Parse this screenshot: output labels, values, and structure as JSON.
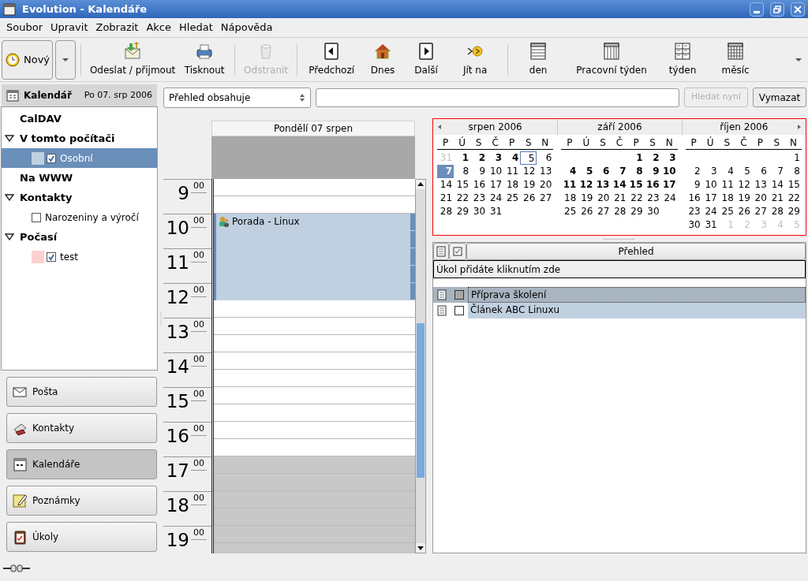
{
  "window": {
    "title": "Evolution - Kalendáře"
  },
  "menu": [
    "Soubor",
    "Upravit",
    "Zobrazit",
    "Akce",
    "Hledat",
    "Nápověda"
  ],
  "toolbar": [
    {
      "kind": "new",
      "label": "Nový",
      "disabled": false
    },
    {
      "kind": "send",
      "label": "Odeslat / přijmout",
      "disabled": false
    },
    {
      "kind": "print",
      "label": "Tisknout",
      "disabled": false
    },
    {
      "kind": "delete",
      "label": "Odstranit",
      "disabled": true
    },
    {
      "kind": "prev",
      "label": "Předchozí",
      "disabled": false
    },
    {
      "kind": "today",
      "label": "Dnes",
      "disabled": false
    },
    {
      "kind": "next",
      "label": "Další",
      "disabled": false
    },
    {
      "kind": "goto",
      "label": "Jít na",
      "disabled": false
    },
    {
      "kind": "day",
      "label": "den",
      "disabled": false
    },
    {
      "kind": "workweek",
      "label": "Pracovní týden",
      "disabled": false
    },
    {
      "kind": "week",
      "label": "týden",
      "disabled": false
    },
    {
      "kind": "month",
      "label": "měsíc",
      "disabled": false
    }
  ],
  "sidebar": {
    "title": "Kalendář",
    "date": "Po 07. srp 2006",
    "tree": [
      {
        "label": "CalDAV"
      },
      {
        "label": "V tomto počítači",
        "expanded": true,
        "children": [
          {
            "label": "Osobní",
            "color": "#c0d0e0",
            "checked": true,
            "selected": true
          }
        ]
      },
      {
        "label": "Na WWW"
      },
      {
        "label": "Kontakty",
        "expanded": true,
        "children": [
          {
            "label": "Narozeniny a výročí",
            "checked": false,
            "selected": false
          }
        ]
      },
      {
        "label": "Počasí",
        "expanded": true,
        "children": [
          {
            "label": "test",
            "color": "#ffd0d0",
            "checked": true,
            "selected": false
          }
        ]
      }
    ],
    "switcher": [
      {
        "kind": "mail",
        "label": "Pošta",
        "selected": false
      },
      {
        "kind": "contacts",
        "label": "Kontakty",
        "selected": false
      },
      {
        "kind": "calendar",
        "label": "Kalendáře",
        "selected": true
      },
      {
        "kind": "memos",
        "label": "Poznámky",
        "selected": false
      },
      {
        "kind": "tasks",
        "label": "Úkoly",
        "selected": false
      }
    ]
  },
  "search": {
    "scope": "Přehled obsahuje",
    "search_button": {
      "label": "Hledat nyní",
      "disabled": true
    },
    "clear_button": "Vymazat"
  },
  "day_view": {
    "header": "Pondělí 07 srpen",
    "hours": [
      {
        "hour": "9",
        "minutes": "00"
      },
      {
        "hour": "10",
        "minutes": "00"
      },
      {
        "hour": "11",
        "minutes": "00"
      },
      {
        "hour": "12",
        "minutes": "00"
      },
      {
        "hour": "13",
        "minutes": "00"
      },
      {
        "hour": "14",
        "minutes": "00"
      },
      {
        "hour": "15",
        "minutes": "00"
      },
      {
        "hour": "16",
        "minutes": "00"
      },
      {
        "hour": "17",
        "minutes": "00"
      },
      {
        "hour": "18",
        "minutes": "00"
      },
      {
        "hour": "19",
        "minutes": "00"
      }
    ],
    "slots": [
      {
        "kind": "free",
        "work": true
      },
      {
        "kind": "free",
        "work": true
      },
      {
        "kind": "event",
        "title": "Porada - Linux",
        "slots": [
          {
            "work": true
          },
          {
            "work": true
          },
          {
            "work": true
          },
          {
            "work": true
          },
          {
            "work": true
          }
        ]
      },
      {
        "kind": "free",
        "work": true
      },
      {
        "kind": "free",
        "work": true
      },
      {
        "kind": "free",
        "work": true
      },
      {
        "kind": "free",
        "work": true
      },
      {
        "kind": "free",
        "work": true
      },
      {
        "kind": "free",
        "work": true
      },
      {
        "kind": "free",
        "work": true
      },
      {
        "kind": "free",
        "work": true
      },
      {
        "kind": "free",
        "work": true
      },
      {
        "kind": "free",
        "work": false
      },
      {
        "kind": "free",
        "work": false
      },
      {
        "kind": "free",
        "work": false
      },
      {
        "kind": "free",
        "work": false
      },
      {
        "kind": "free",
        "work": false
      },
      {
        "kind": "free",
        "work": false
      }
    ]
  },
  "mini_calendar": {
    "months": [
      {
        "title": "srpen 2006",
        "weekdays": [
          "P",
          "Ú",
          "S",
          "Č",
          "P",
          "S",
          "N"
        ],
        "weeks": [
          [
            {
              "d": "31",
              "kind": "other"
            },
            {
              "d": "1",
              "kind": "busy"
            },
            {
              "d": "2",
              "kind": "busy"
            },
            {
              "d": "3",
              "kind": "busy"
            },
            {
              "d": "4",
              "kind": "busy"
            },
            {
              "d": "5",
              "kind": "today"
            },
            {
              "d": "6",
              "kind": "plain"
            }
          ],
          [
            {
              "d": "7",
              "kind": "selected"
            },
            {
              "d": "8",
              "kind": "plain"
            },
            {
              "d": "9",
              "kind": "plain"
            },
            {
              "d": "10",
              "kind": "plain"
            },
            {
              "d": "11",
              "kind": "plain"
            },
            {
              "d": "12",
              "kind": "plain"
            },
            {
              "d": "13",
              "kind": "plain"
            }
          ],
          [
            {
              "d": "14",
              "kind": "plain"
            },
            {
              "d": "15",
              "kind": "plain"
            },
            {
              "d": "16",
              "kind": "plain"
            },
            {
              "d": "17",
              "kind": "plain"
            },
            {
              "d": "18",
              "kind": "plain"
            },
            {
              "d": "19",
              "kind": "plain"
            },
            {
              "d": "20",
              "kind": "plain"
            }
          ],
          [
            {
              "d": "21",
              "kind": "plain"
            },
            {
              "d": "22",
              "kind": "plain"
            },
            {
              "d": "23",
              "kind": "plain"
            },
            {
              "d": "24",
              "kind": "plain"
            },
            {
              "d": "25",
              "kind": "plain"
            },
            {
              "d": "26",
              "kind": "plain"
            },
            {
              "d": "27",
              "kind": "plain"
            }
          ],
          [
            {
              "d": "28",
              "kind": "plain"
            },
            {
              "d": "29",
              "kind": "plain"
            },
            {
              "d": "30",
              "kind": "plain"
            },
            {
              "d": "31",
              "kind": "plain"
            },
            {
              "kind": "blank"
            },
            {
              "kind": "blank"
            },
            {
              "kind": "blank"
            }
          ]
        ]
      },
      {
        "title": "září 2006",
        "weekdays": [
          "P",
          "Ú",
          "S",
          "Č",
          "P",
          "S",
          "N"
        ],
        "weeks": [
          [
            {
              "kind": "blank"
            },
            {
              "kind": "blank"
            },
            {
              "kind": "blank"
            },
            {
              "kind": "blank"
            },
            {
              "d": "1",
              "kind": "busy"
            },
            {
              "d": "2",
              "kind": "busy"
            },
            {
              "d": "3",
              "kind": "busy"
            }
          ],
          [
            {
              "d": "4",
              "kind": "busy"
            },
            {
              "d": "5",
              "kind": "busy"
            },
            {
              "d": "6",
              "kind": "busy"
            },
            {
              "d": "7",
              "kind": "busy"
            },
            {
              "d": "8",
              "kind": "busy"
            },
            {
              "d": "9",
              "kind": "busy"
            },
            {
              "d": "10",
              "kind": "busy"
            }
          ],
          [
            {
              "d": "11",
              "kind": "busy"
            },
            {
              "d": "12",
              "kind": "busy"
            },
            {
              "d": "13",
              "kind": "busy"
            },
            {
              "d": "14",
              "kind": "busy"
            },
            {
              "d": "15",
              "kind": "busy"
            },
            {
              "d": "16",
              "kind": "busy"
            },
            {
              "d": "17",
              "kind": "busy"
            }
          ],
          [
            {
              "d": "18",
              "kind": "plain"
            },
            {
              "d": "19",
              "kind": "plain"
            },
            {
              "d": "20",
              "kind": "plain"
            },
            {
              "d": "21",
              "kind": "plain"
            },
            {
              "d": "22",
              "kind": "plain"
            },
            {
              "d": "23",
              "kind": "plain"
            },
            {
              "d": "24",
              "kind": "plain"
            }
          ],
          [
            {
              "d": "25",
              "kind": "plain"
            },
            {
              "d": "26",
              "kind": "plain"
            },
            {
              "d": "27",
              "kind": "plain"
            },
            {
              "d": "28",
              "kind": "plain"
            },
            {
              "d": "29",
              "kind": "plain"
            },
            {
              "d": "30",
              "kind": "plain"
            },
            {
              "kind": "blank"
            }
          ]
        ]
      },
      {
        "title": "říjen 2006",
        "weekdays": [
          "P",
          "Ú",
          "S",
          "Č",
          "P",
          "S",
          "N"
        ],
        "weeks": [
          [
            {
              "kind": "blank"
            },
            {
              "kind": "blank"
            },
            {
              "kind": "blank"
            },
            {
              "kind": "blank"
            },
            {
              "kind": "blank"
            },
            {
              "kind": "blank"
            },
            {
              "d": "1",
              "kind": "plain"
            }
          ],
          [
            {
              "d": "2",
              "kind": "plain"
            },
            {
              "d": "3",
              "kind": "plain"
            },
            {
              "d": "4",
              "kind": "plain"
            },
            {
              "d": "5",
              "kind": "plain"
            },
            {
              "d": "6",
              "kind": "plain"
            },
            {
              "d": "7",
              "kind": "plain"
            },
            {
              "d": "8",
              "kind": "plain"
            }
          ],
          [
            {
              "d": "9",
              "kind": "plain"
            },
            {
              "d": "10",
              "kind": "plain"
            },
            {
              "d": "11",
              "kind": "plain"
            },
            {
              "d": "12",
              "kind": "plain"
            },
            {
              "d": "13",
              "kind": "plain"
            },
            {
              "d": "14",
              "kind": "plain"
            },
            {
              "d": "15",
              "kind": "plain"
            }
          ],
          [
            {
              "d": "16",
              "kind": "plain"
            },
            {
              "d": "17",
              "kind": "plain"
            },
            {
              "d": "18",
              "kind": "plain"
            },
            {
              "d": "19",
              "kind": "plain"
            },
            {
              "d": "20",
              "kind": "plain"
            },
            {
              "d": "21",
              "kind": "plain"
            },
            {
              "d": "22",
              "kind": "plain"
            }
          ],
          [
            {
              "d": "23",
              "kind": "plain"
            },
            {
              "d": "24",
              "kind": "plain"
            },
            {
              "d": "25",
              "kind": "plain"
            },
            {
              "d": "26",
              "kind": "plain"
            },
            {
              "d": "27",
              "kind": "plain"
            },
            {
              "d": "28",
              "kind": "plain"
            },
            {
              "d": "29",
              "kind": "plain"
            }
          ],
          [
            {
              "d": "30",
              "kind": "plain"
            },
            {
              "d": "31",
              "kind": "plain"
            },
            {
              "d": "1",
              "kind": "other"
            },
            {
              "d": "2",
              "kind": "other"
            },
            {
              "d": "3",
              "kind": "other"
            },
            {
              "d": "4",
              "kind": "other"
            },
            {
              "d": "5",
              "kind": "other"
            }
          ]
        ]
      }
    ]
  },
  "tasks": {
    "column": "Přehled",
    "new_task_hint": "Úkol přidáte kliknutím zde",
    "rows": [
      {
        "summary": "Příprava školení",
        "done": false,
        "selected": true
      },
      {
        "summary": "Článek ABC Linuxu",
        "done": false,
        "selected": false
      }
    ]
  }
}
